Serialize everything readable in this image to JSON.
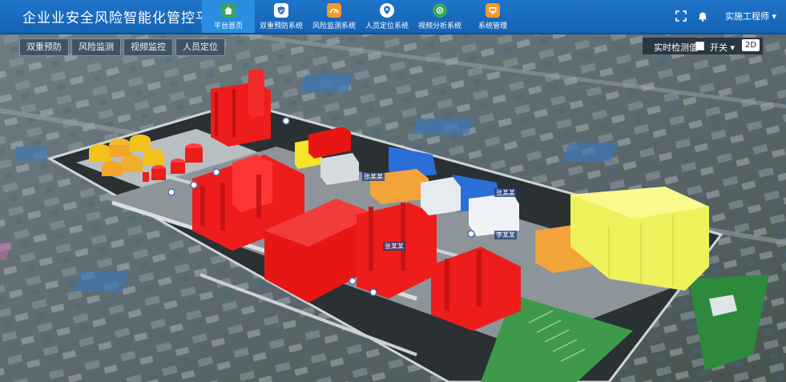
{
  "header": {
    "title": "企业业安全风险智能化管控平台",
    "nav": [
      {
        "label": "平台首页",
        "icon": "home-icon",
        "active": true
      },
      {
        "label": "双重预防系统",
        "icon": "shield-icon",
        "active": false
      },
      {
        "label": "风险监测系统",
        "icon": "dashboard-icon",
        "active": false
      },
      {
        "label": "人员定位系统",
        "icon": "location-pin-icon",
        "active": false
      },
      {
        "label": "视频分析系统",
        "icon": "video-analysis-icon",
        "active": false
      },
      {
        "label": "系统管理",
        "icon": "monitor-settings-icon",
        "active": false
      }
    ],
    "user": "实施工程师 ▾"
  },
  "subtabs": [
    "双重预防",
    "风险监测",
    "视频监控",
    "人员定位"
  ],
  "controls": {
    "realtime_label": "实时检测值",
    "toggle_label": "开关 ▾",
    "view_2d": "2D"
  },
  "map_labels": [
    "张某某",
    "张某某",
    "李某某",
    "张某某"
  ],
  "colors": {
    "header": "#1a6bbd",
    "hazard_red": "#ef1c1c",
    "building_yellow": "#eef25a",
    "building_orange": "#f2a33a",
    "building_blue": "#2b6ed8"
  }
}
